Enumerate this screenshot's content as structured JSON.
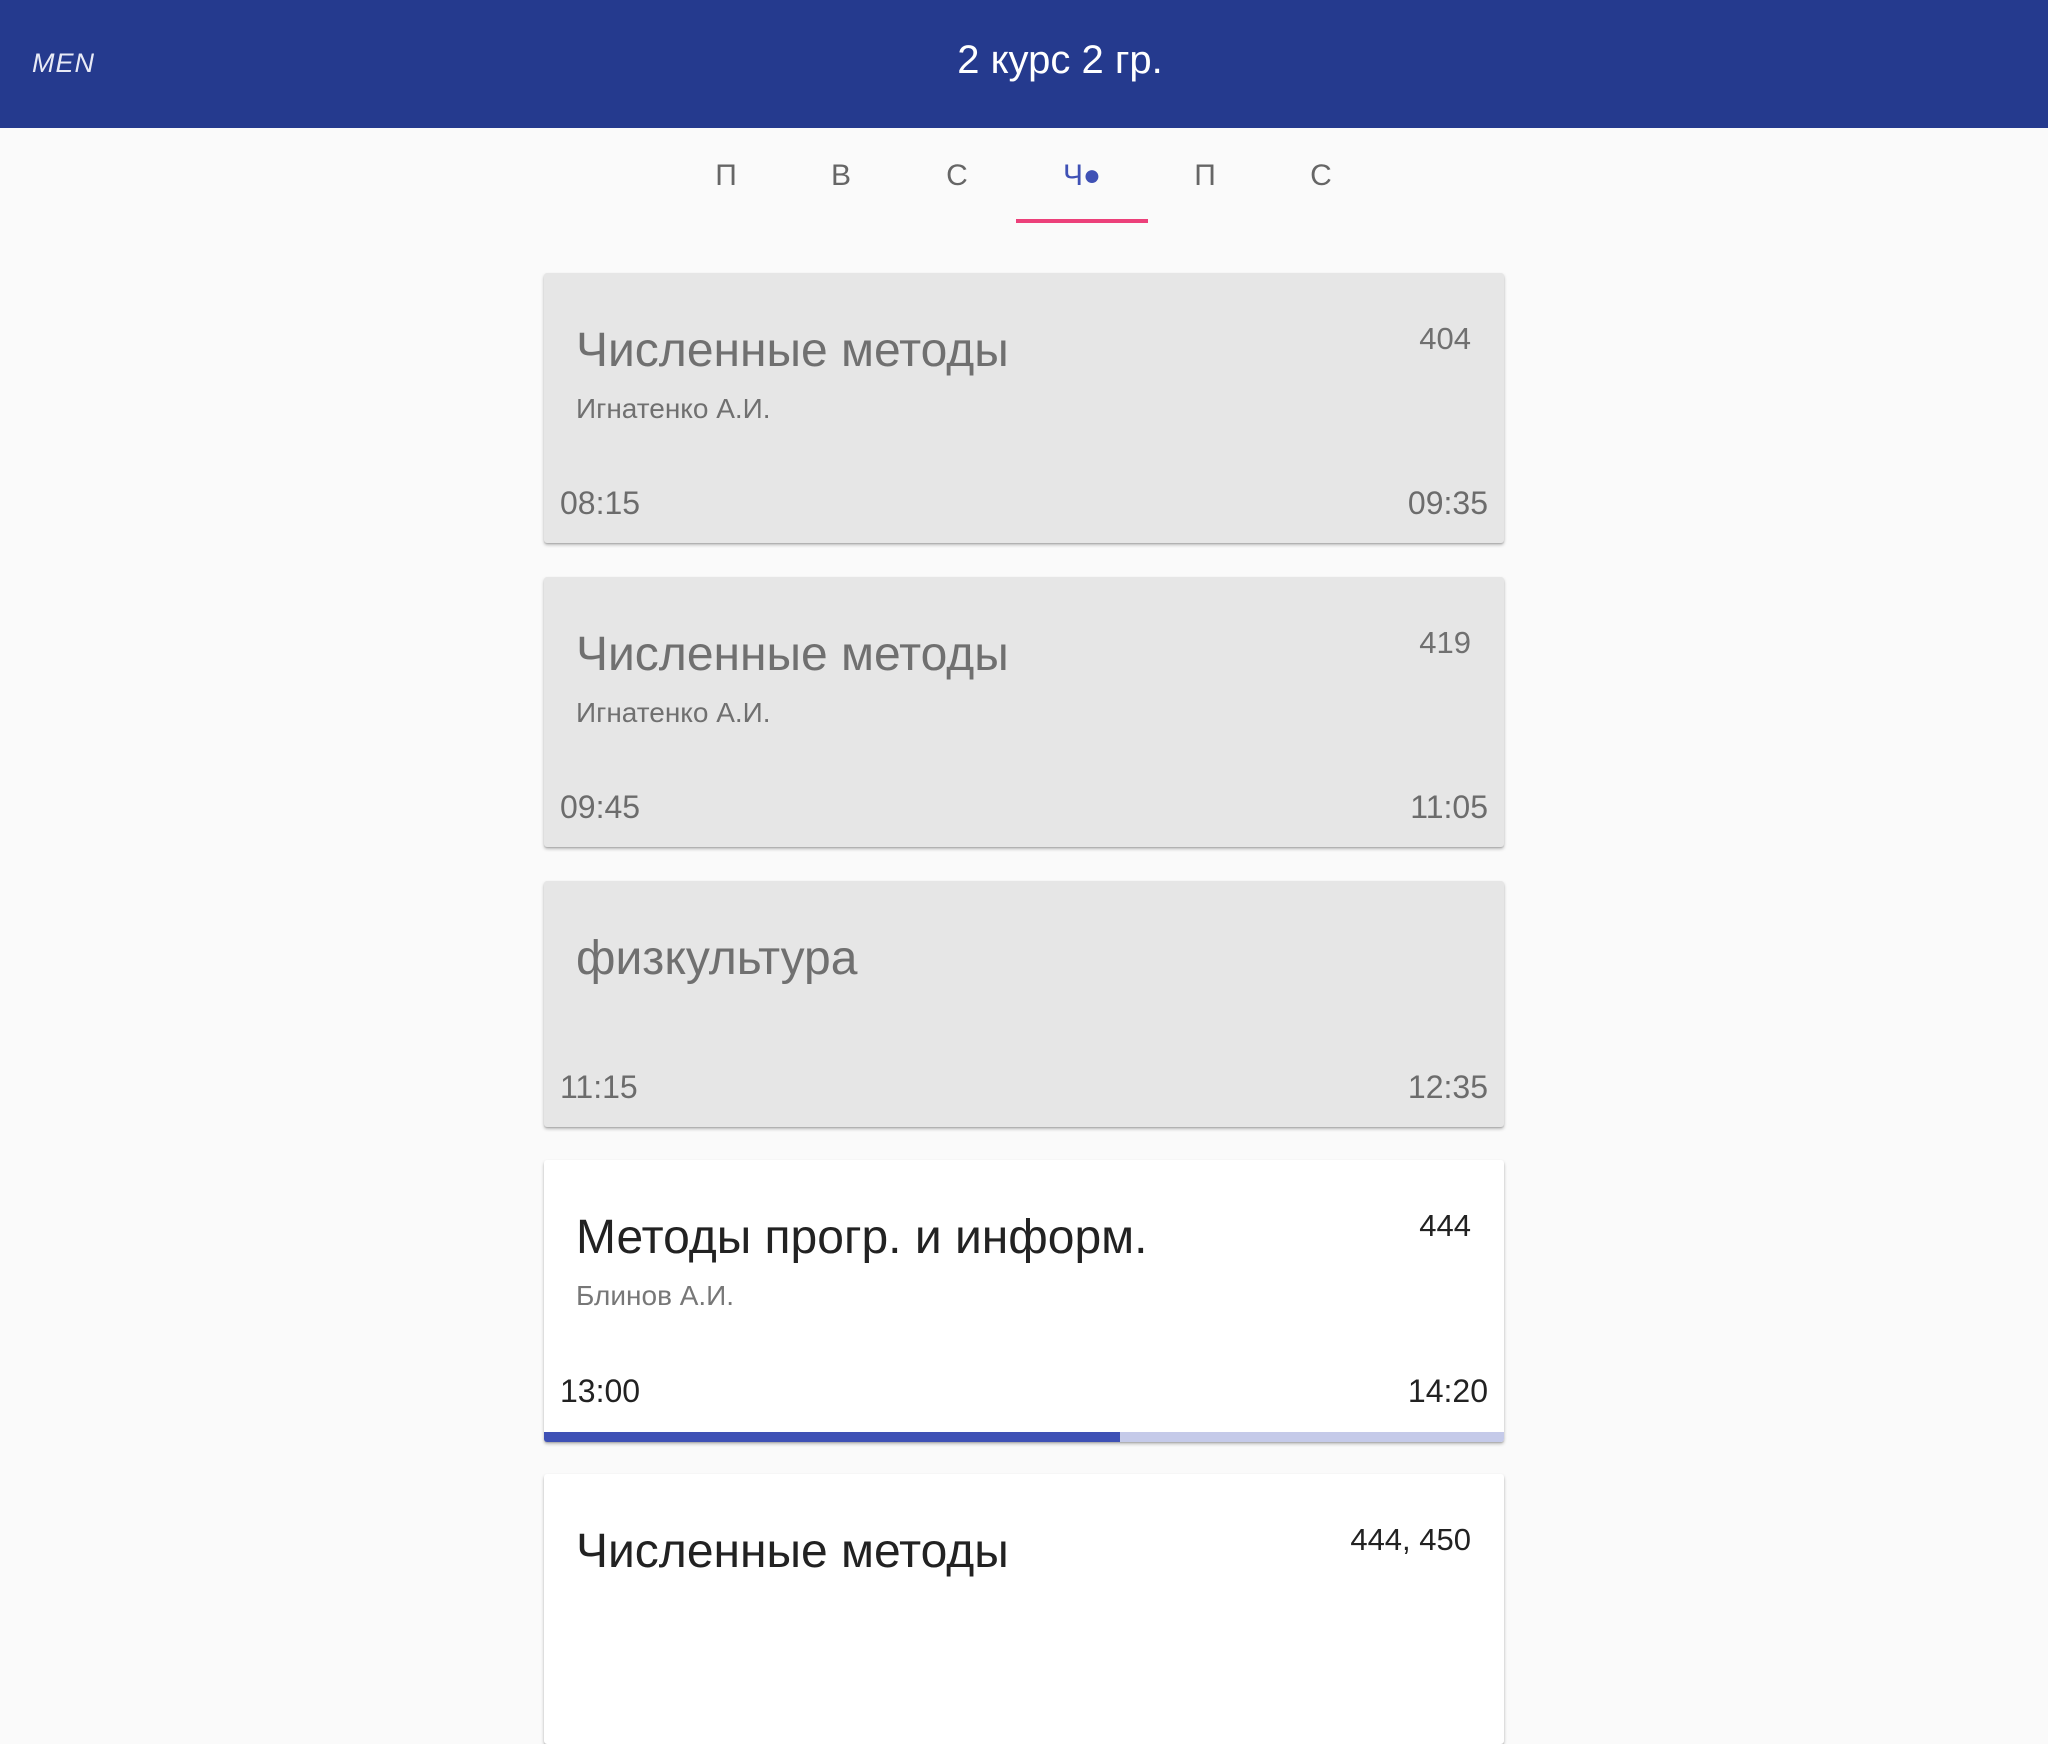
{
  "appbar": {
    "menu_label": "MEN",
    "title": "2 курс 2 гр."
  },
  "tabs": [
    {
      "label": "П",
      "active": false
    },
    {
      "label": "В",
      "active": false
    },
    {
      "label": "С",
      "active": false
    },
    {
      "label": "Ч●",
      "active": true
    },
    {
      "label": "П",
      "active": false
    },
    {
      "label": "С",
      "active": false
    }
  ],
  "colors": {
    "appbar": "#253a8e",
    "accent": "#3f51b5",
    "tab_indicator": "#ec407a",
    "past_card": "#e6e6e6",
    "current_card": "#ffffff"
  },
  "lessons": [
    {
      "subject": "Численные методы",
      "teacher": "Игнатенко А.И.",
      "room": "404",
      "start": "08:15",
      "end": "09:35",
      "state": "past"
    },
    {
      "subject": "Численные методы",
      "teacher": "Игнатенко А.И.",
      "room": "419",
      "start": "09:45",
      "end": "11:05",
      "state": "past"
    },
    {
      "subject": "физкультура",
      "teacher": "",
      "room": "",
      "start": "11:15",
      "end": "12:35",
      "state": "past"
    },
    {
      "subject": "Методы прогр. и информ.",
      "teacher": "Блинов А.И.",
      "room": "444",
      "start": "13:00",
      "end": "14:20",
      "state": "current",
      "progress": 0.6
    },
    {
      "subject": "Численные методы",
      "teacher": "",
      "room": "444, 450",
      "start": "",
      "end": "",
      "state": "upcoming"
    }
  ]
}
